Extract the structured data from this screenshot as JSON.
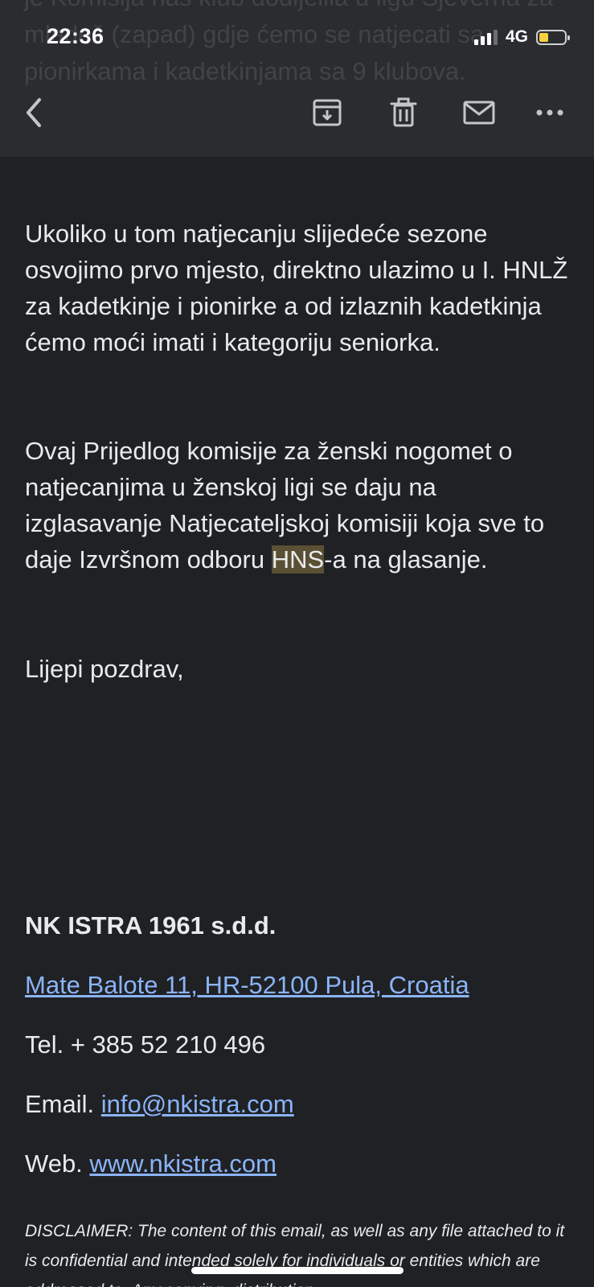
{
  "status_bar": {
    "time": "22:36",
    "network": "4G",
    "battery_level": 0.35,
    "battery_color": "#f5d142"
  },
  "scrolled_text": "je Komisija naš klub dodijelila u ligu Sjeverna za mladež (zapad) gdje ćemo se natjecati sa pionirkama i kadetkinjama sa 9 klubova.",
  "toolbar": {
    "back_icon": "chevron-left-icon",
    "archive_icon": "archive-icon",
    "delete_icon": "trash-icon",
    "mark_unread_icon": "mail-icon",
    "more_icon": "more-horizontal-icon"
  },
  "email": {
    "paragraph1": "Ukoliko u tom natjecanju slijedeće sezone osvojimo prvo mjesto, direktno ulazimo u I. HNLŽ za kadetkinje i pionirke a od izlaznih kadetkinja ćemo moći imati i kategoriju seniorka.",
    "paragraph2_before": "Ovaj Prijedlog komisije za ženski nogomet o natjecanjima u ženskoj ligi se daju na izglasavanje Natjecateljskoj komisiji koja sve to daje Izvršnom odboru ",
    "paragraph2_highlight": "HNS",
    "paragraph2_after": "-a na glasanje.",
    "greeting": "Lijepi pozdrav,"
  },
  "signature": {
    "org_name": "NK ISTRA 1961 s.d.d.",
    "address": "Mate Balote 11, HR-52100 Pula, Croatia",
    "tel": "Tel. + 385 52 210 496",
    "email_label": "Email.",
    "email": "info@nkistra.com",
    "web_label": "Web.",
    "web": "www.nkistra.com",
    "disclaimer": "DISCLAIMER: The content of this email, as well as any file attached to it is confidential and intended solely for individuals or entities which are addressed to. Any copying, distribution"
  },
  "colors": {
    "background": "#202124",
    "toolbar": "#2b2c2f",
    "text": "#e8eaed",
    "link": "#8ab4f8",
    "highlight": "#5a5033"
  }
}
